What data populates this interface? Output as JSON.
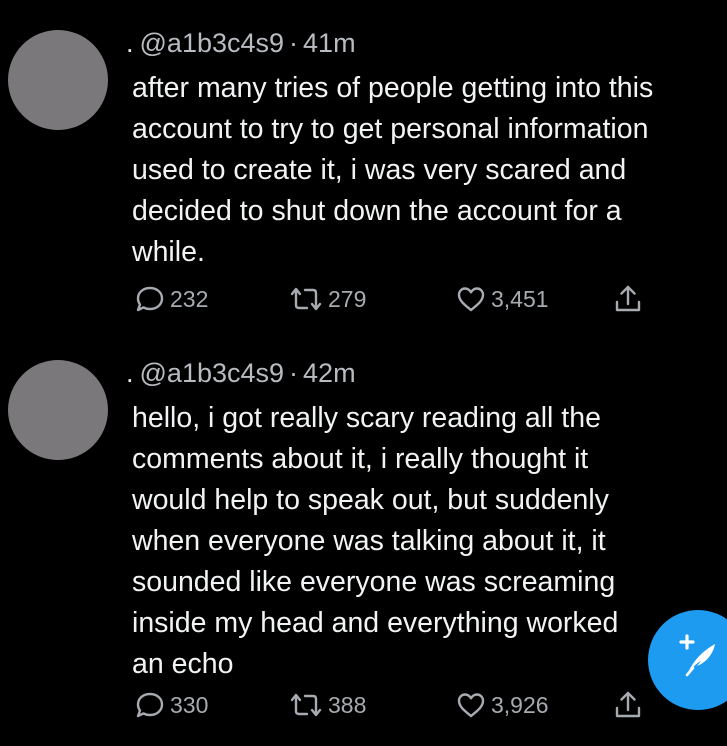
{
  "tweets": [
    {
      "handle": "@a1b3c4s9",
      "time": "41m",
      "text": "after many tries of people getting into this\naccount to try to get personal information\nused to create it, i was very scared and\ndecided to shut down the account for a\nwhile.",
      "replies": "232",
      "retweets": "279",
      "likes": "3,451"
    },
    {
      "handle": "@a1b3c4s9",
      "time": "42m",
      "text": "hello, i got really scary reading all the\ncomments about it, i really thought it\nwould help to speak out, but suddenly\nwhen everyone was talking about it, it\nsounded like everyone was screaming\ninside my head and everything worked\nan echo",
      "replies": "330",
      "retweets": "388",
      "likes": "3,926"
    }
  ],
  "icons": {
    "reply": "reply-icon",
    "retweet": "retweet-icon",
    "like": "heart-icon",
    "share": "share-icon",
    "compose": "compose-tweet-icon"
  },
  "colors": {
    "background": "#000000",
    "text": "#f2f3f4",
    "secondary": "#a7abb0",
    "avatar": "#7b787c",
    "accent": "#1d9bf0"
  }
}
